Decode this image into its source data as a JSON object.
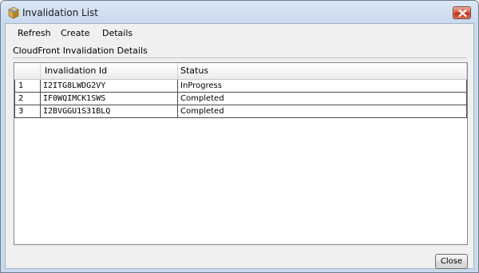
{
  "window": {
    "title": "Invalidation List",
    "icon": "package-box-icon"
  },
  "menu": {
    "refresh": "Refresh",
    "create": "Create",
    "details": "Details"
  },
  "section": {
    "title": "CloudFront Invalidation Details"
  },
  "table": {
    "columns": {
      "number": "",
      "invalidation_id": "Invalidation Id",
      "status": "Status"
    },
    "rows": [
      {
        "num": "1",
        "id": "I2ITG8LWDG2VY",
        "status": "InProgress"
      },
      {
        "num": "2",
        "id": "IF0WQIMCK1SWS",
        "status": "Completed"
      },
      {
        "num": "3",
        "id": "I2BVGGU1S31BLQ",
        "status": "Completed"
      }
    ]
  },
  "buttons": {
    "close": "Close"
  },
  "colors": {
    "title_bar": "#c9d9ee",
    "close_button_red": "#c1321a",
    "dialog_background": "#f0f0f0",
    "table_border": "#4c4c4c"
  }
}
